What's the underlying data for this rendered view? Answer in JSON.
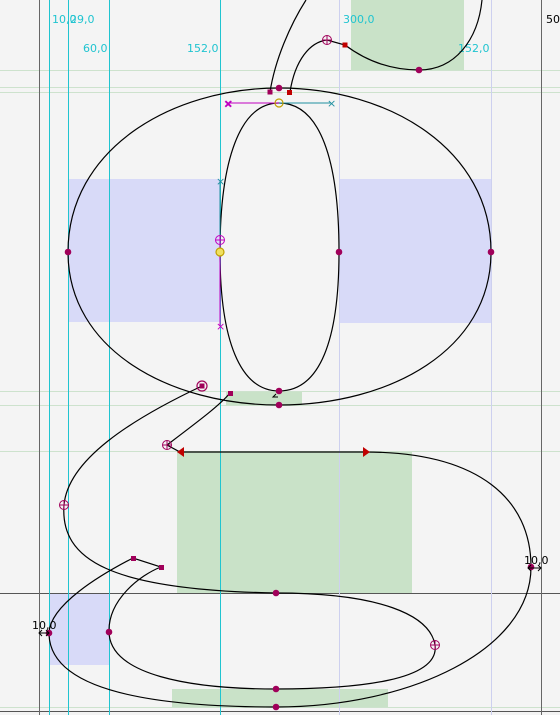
{
  "editor": {
    "labels_top": [
      "10,0",
      "29,0",
      "300,0",
      "50"
    ],
    "labels_second": [
      "60,0",
      "152,0",
      "152,0"
    ],
    "labels_side": [
      "10,0",
      "10,0"
    ]
  },
  "colors": {
    "background": "#f4f4f4",
    "guide_cyan": "#20c4d0",
    "hint_blue": "#d8daf8",
    "hint_green": "#c9e2c8",
    "point": "#a0005a",
    "outline": "#000000",
    "handle_magenta": "#c000c0"
  }
}
